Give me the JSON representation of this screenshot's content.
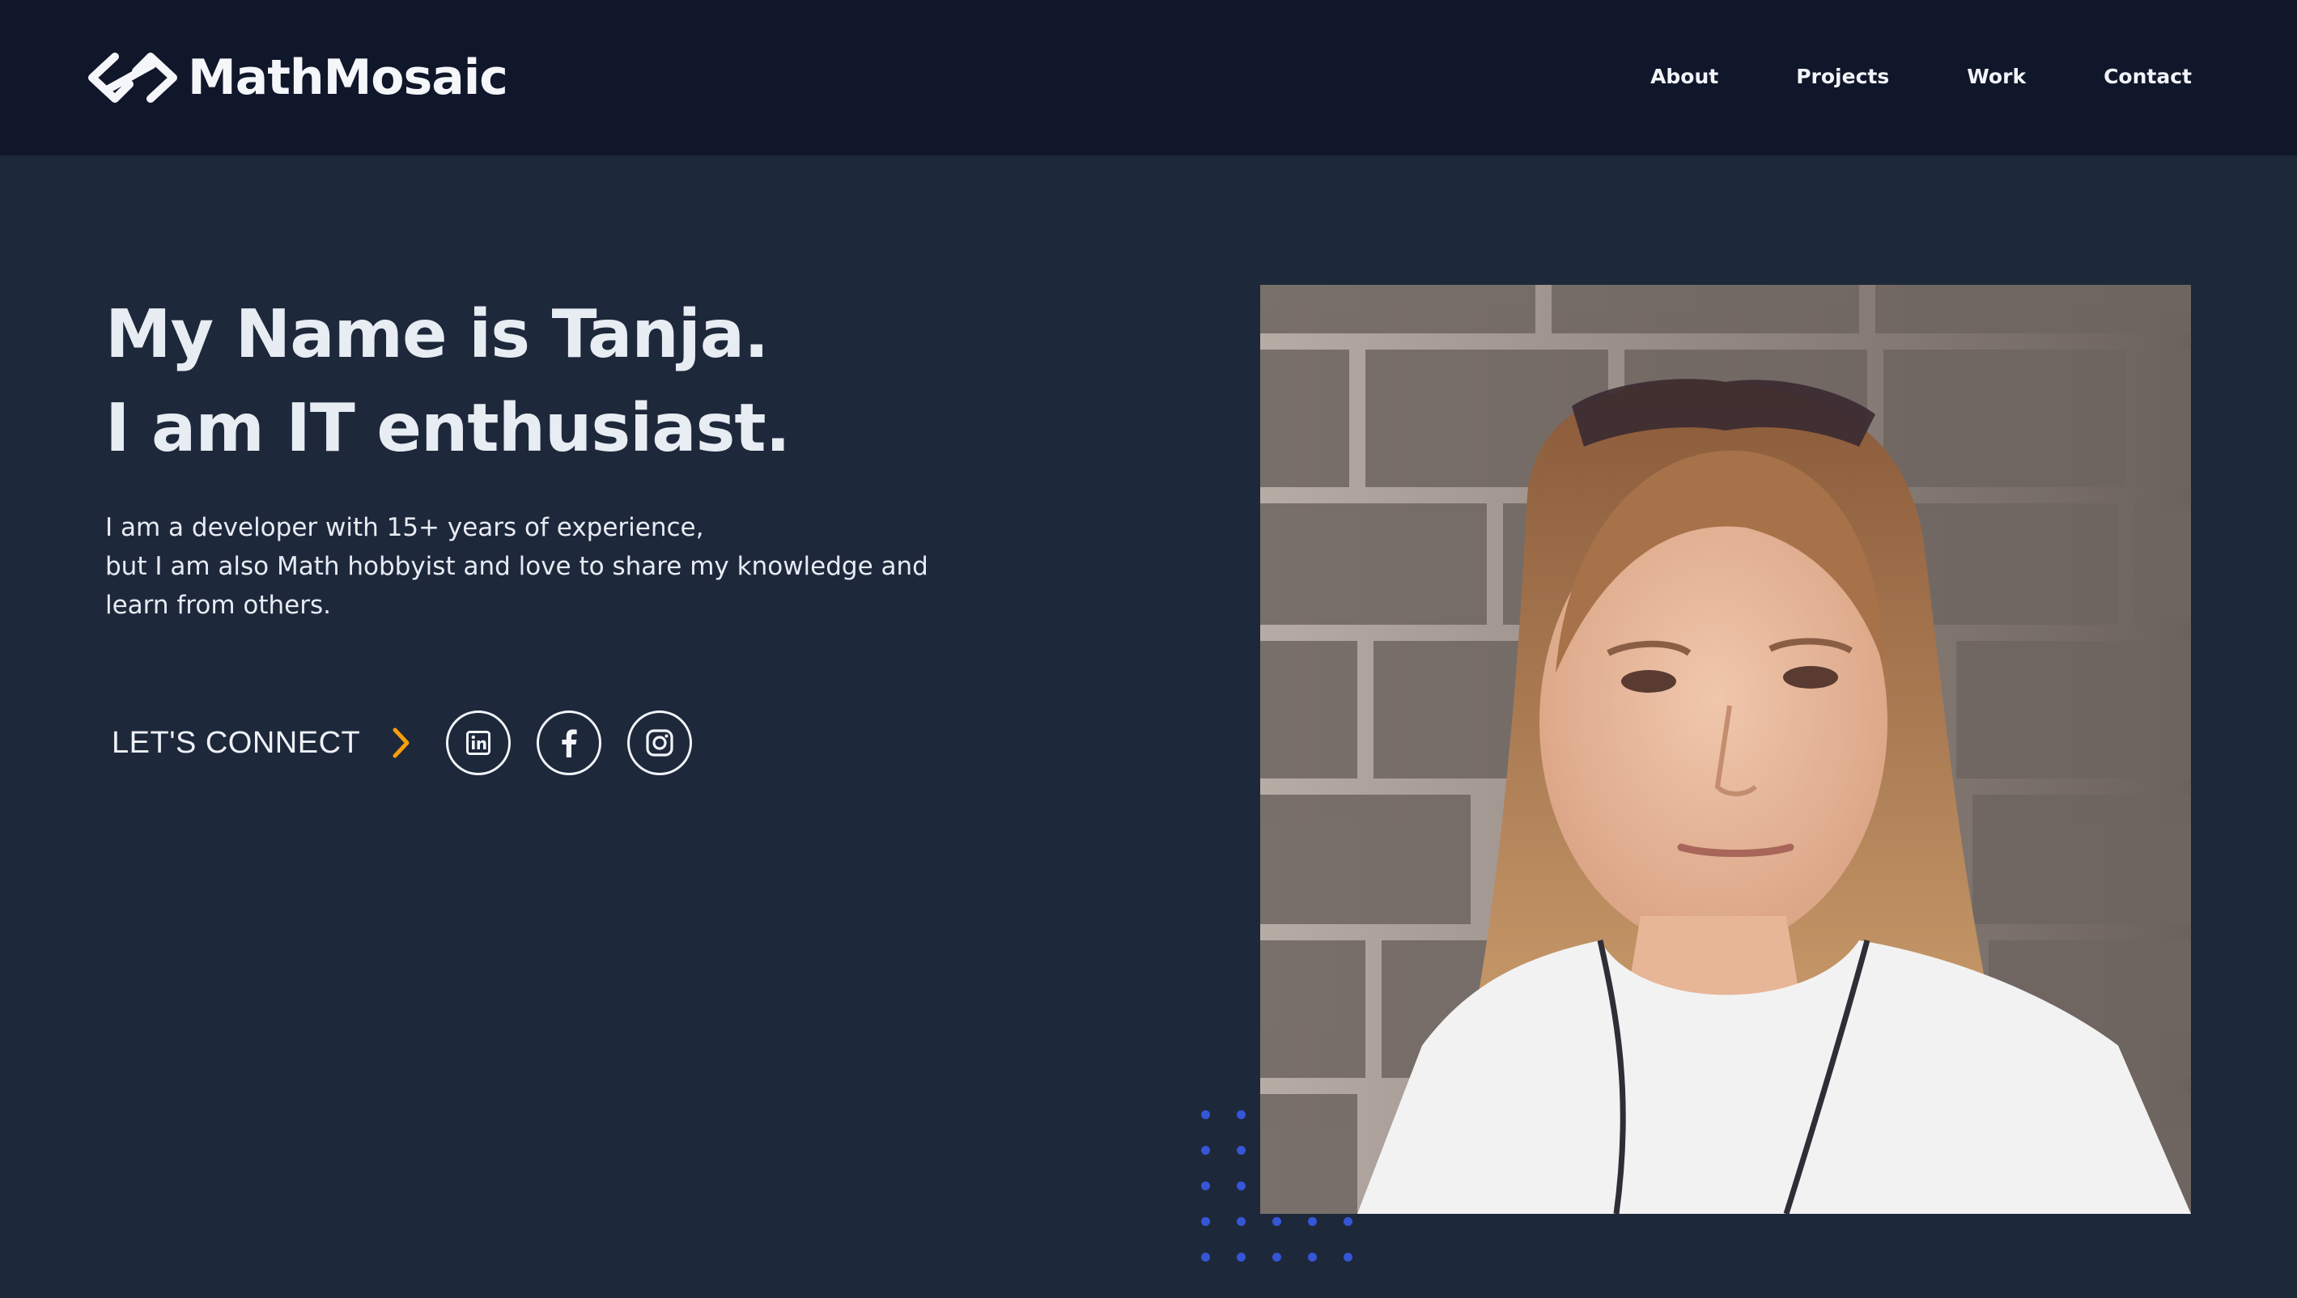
{
  "brand": {
    "name": "MathMosaic",
    "logo_icon": "chain-link-logo-icon"
  },
  "nav": {
    "links": [
      "About",
      "Projects",
      "Work",
      "Contact"
    ]
  },
  "hero": {
    "headline": [
      "My Name is Tanja.",
      "I am IT enthusiast."
    ],
    "description": [
      "I am a developer with 15+ years of experience,",
      "but I am also Math hobbyist and love to share my knowledge and",
      "learn from others."
    ],
    "connect_label": "LET'S CONNECT",
    "connect_icon": "chevron-right-icon",
    "social": [
      {
        "name": "linkedin",
        "icon": "linkedin-icon"
      },
      {
        "name": "facebook",
        "icon": "facebook-icon"
      },
      {
        "name": "instagram",
        "icon": "instagram-icon"
      }
    ],
    "photo_alt": "Portrait of Tanja"
  },
  "colors": {
    "page_bg": "#1e283b",
    "navbar_bg": "#11172a",
    "text": "#e8ecf3",
    "accent_orange": "#f59e0b",
    "dot_blue": "#3556d6"
  }
}
